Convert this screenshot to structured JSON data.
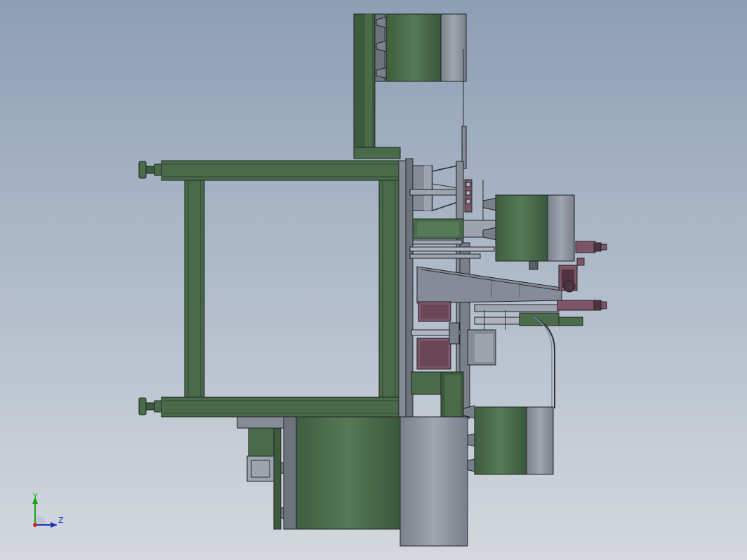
{
  "triad": {
    "y_label": "Y",
    "z_label": "Z"
  },
  "colors": {
    "bg_top": "#8d9fb5",
    "bg_bottom": "#d4d8de",
    "green": "#4a6b4a",
    "green_dark": "#2e452f",
    "green_mid": "#3d5a3d",
    "gray": "#868b97",
    "gray_light": "#9ea3ae",
    "gray_dark": "#5a5e66",
    "purple": "#7d5566",
    "purple_dark": "#4f3440",
    "line": "#1f2326"
  }
}
